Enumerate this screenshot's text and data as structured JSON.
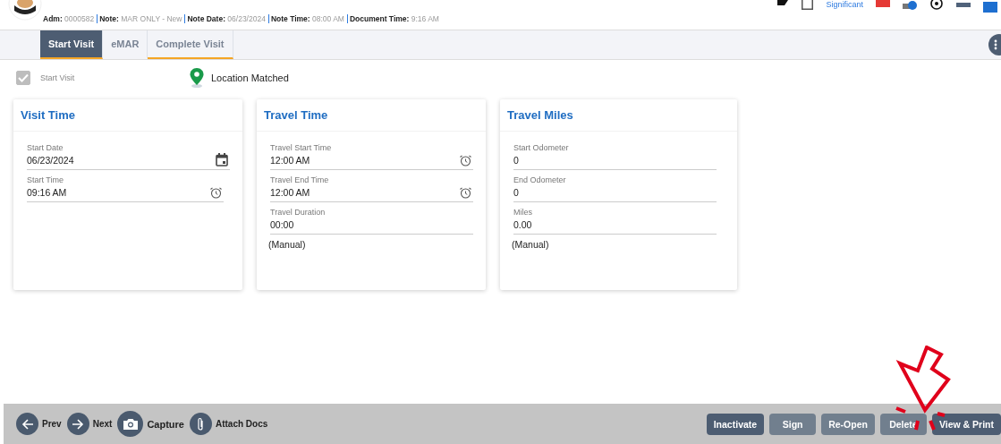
{
  "header": {
    "fields": [
      {
        "label": "Adm:",
        "value": "0000582"
      },
      {
        "label": "Note:",
        "value": "MAR ONLY - New"
      },
      {
        "label": "Note Date:",
        "value": "06/23/2024"
      },
      {
        "label": "Note Time:",
        "value": "08:00 AM"
      },
      {
        "label": "Document Time:",
        "value": "9:16 AM"
      }
    ],
    "significant_link": "Significant"
  },
  "tabs": [
    {
      "label": "Start Visit",
      "selected": true,
      "underlined": true
    },
    {
      "label": "eMAR",
      "selected": false,
      "underlined": false
    },
    {
      "label": "Complete Visit",
      "selected": false,
      "underlined": true
    }
  ],
  "start_visit": {
    "label": "Start Visit",
    "checked": true,
    "disabled": true
  },
  "location": {
    "label": "Location Matched"
  },
  "cards": [
    {
      "title": "Visit Time",
      "fields": [
        {
          "label": "Start Date",
          "value": "06/23/2024",
          "kind": "date"
        },
        {
          "label": "Start Time",
          "value": "09:16 AM",
          "kind": "time"
        }
      ]
    },
    {
      "title": "Travel Time",
      "fields": [
        {
          "label": "Travel Start Time",
          "value": "12:00 AM",
          "kind": "time"
        },
        {
          "label": "Travel End Time",
          "value": "12:00 AM",
          "kind": "time"
        },
        {
          "label": "Travel Duration",
          "value": "00:00",
          "kind": "text"
        }
      ],
      "note": "(Manual)"
    },
    {
      "title": "Travel Miles",
      "fields": [
        {
          "label": "Start Odometer",
          "value": "0",
          "kind": "text"
        },
        {
          "label": "End Odometer",
          "value": "0",
          "kind": "text"
        },
        {
          "label": "Miles",
          "value": "0.00",
          "kind": "text"
        }
      ],
      "note": "(Manual)"
    }
  ],
  "footer": {
    "nav": [
      {
        "label": "Prev",
        "kind": "prev"
      },
      {
        "label": "Next",
        "kind": "next"
      },
      {
        "label": "Capture",
        "kind": "camera"
      },
      {
        "label": "Attach Docs",
        "kind": "attach"
      }
    ],
    "actions": [
      {
        "label": "Inactivate",
        "disabled": false
      },
      {
        "label": "Sign",
        "disabled": true
      },
      {
        "label": "Re-Open",
        "disabled": true
      },
      {
        "label": "Delete",
        "disabled": true
      },
      {
        "label": "View & Print",
        "disabled": false
      }
    ]
  }
}
